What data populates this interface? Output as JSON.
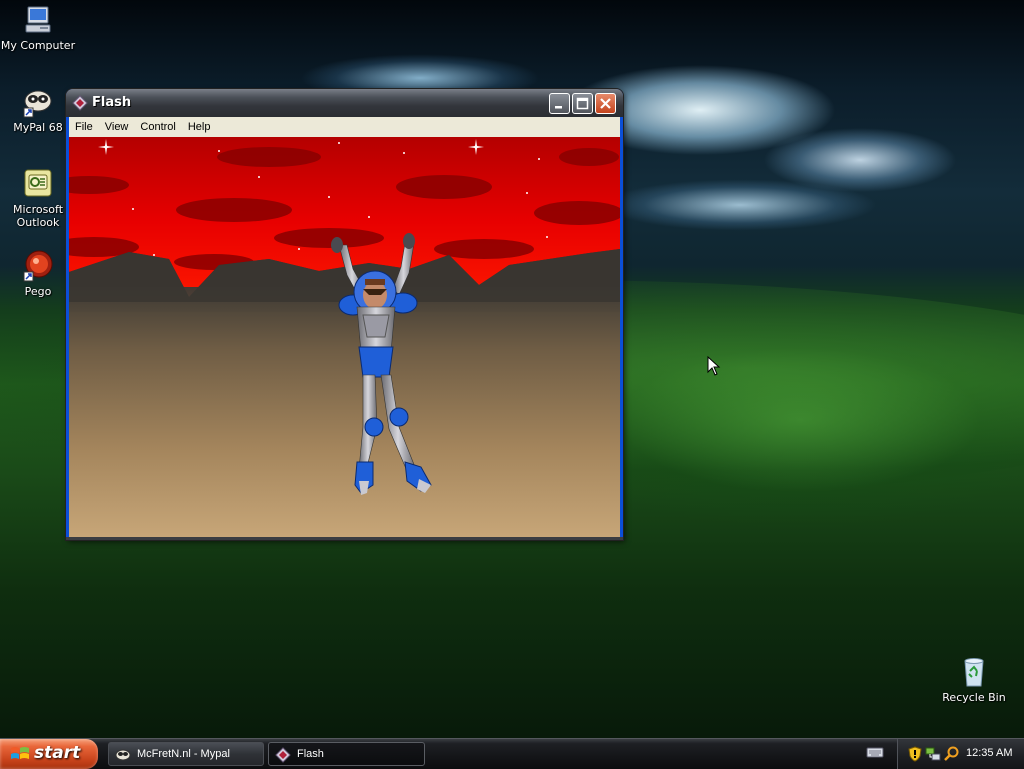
{
  "desktop": {
    "icons": [
      {
        "label": "My Computer",
        "icon": "my-computer-icon"
      },
      {
        "label": "MyPal 68",
        "icon": "mypal-icon"
      },
      {
        "label": "Microsoft Outlook",
        "icon": "outlook-icon"
      },
      {
        "label": "Pego",
        "icon": "pego-icon"
      },
      {
        "label": "Recycle Bin",
        "icon": "recycle-bin-icon"
      }
    ]
  },
  "window": {
    "title": "Flash",
    "icon": "flash-icon",
    "menu": [
      "File",
      "View",
      "Control",
      "Help"
    ],
    "buttons": [
      "minimize",
      "maximize",
      "close"
    ]
  },
  "taskbar": {
    "start_label": "start",
    "tasks": [
      {
        "label": "McFretN.nl - Mypal",
        "icon": "mypal-icon",
        "active": false
      },
      {
        "label": "Flash",
        "icon": "flash-icon",
        "active": true
      }
    ],
    "tray_icons": [
      "keyboard-icon",
      "security-shield-icon",
      "network-icon",
      "search-icon"
    ],
    "clock": "12:35 AM"
  },
  "colors": {
    "sky_red": "#e00000",
    "ground": "#b08f64",
    "taskbar": "#1a1b1e",
    "start": "#d9532a"
  }
}
